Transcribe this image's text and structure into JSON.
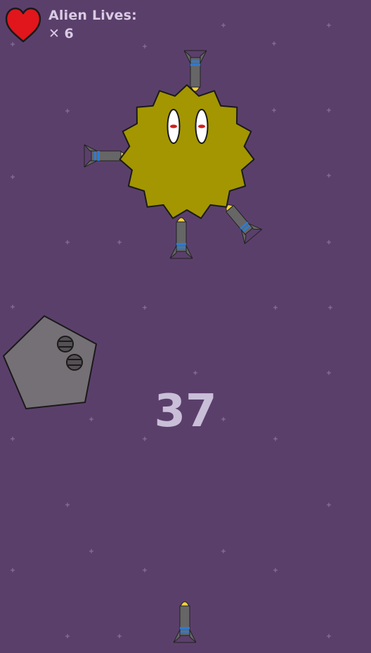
{
  "hud": {
    "lives_label": "Alien Lives:",
    "lives_count": "✕ 6",
    "heart_icon": "heart-icon"
  },
  "score": "37",
  "colors": {
    "background": "#5b3f6b",
    "alien_body": "#a39600",
    "heart": "#e0161c",
    "rock": "#757075",
    "rocket_body": "#666666",
    "rocket_tip": "#f4d03f",
    "rocket_band": "#2e7bd1",
    "hud_text": "#d9cbe3"
  },
  "entities": {
    "alien": "spiky-alien",
    "asteroid": "pentagon-asteroid",
    "player_rocket": "player-rocket",
    "stuck_rockets": [
      "rocket-top",
      "rocket-left",
      "rocket-bottom",
      "rocket-bottom-right"
    ]
  }
}
